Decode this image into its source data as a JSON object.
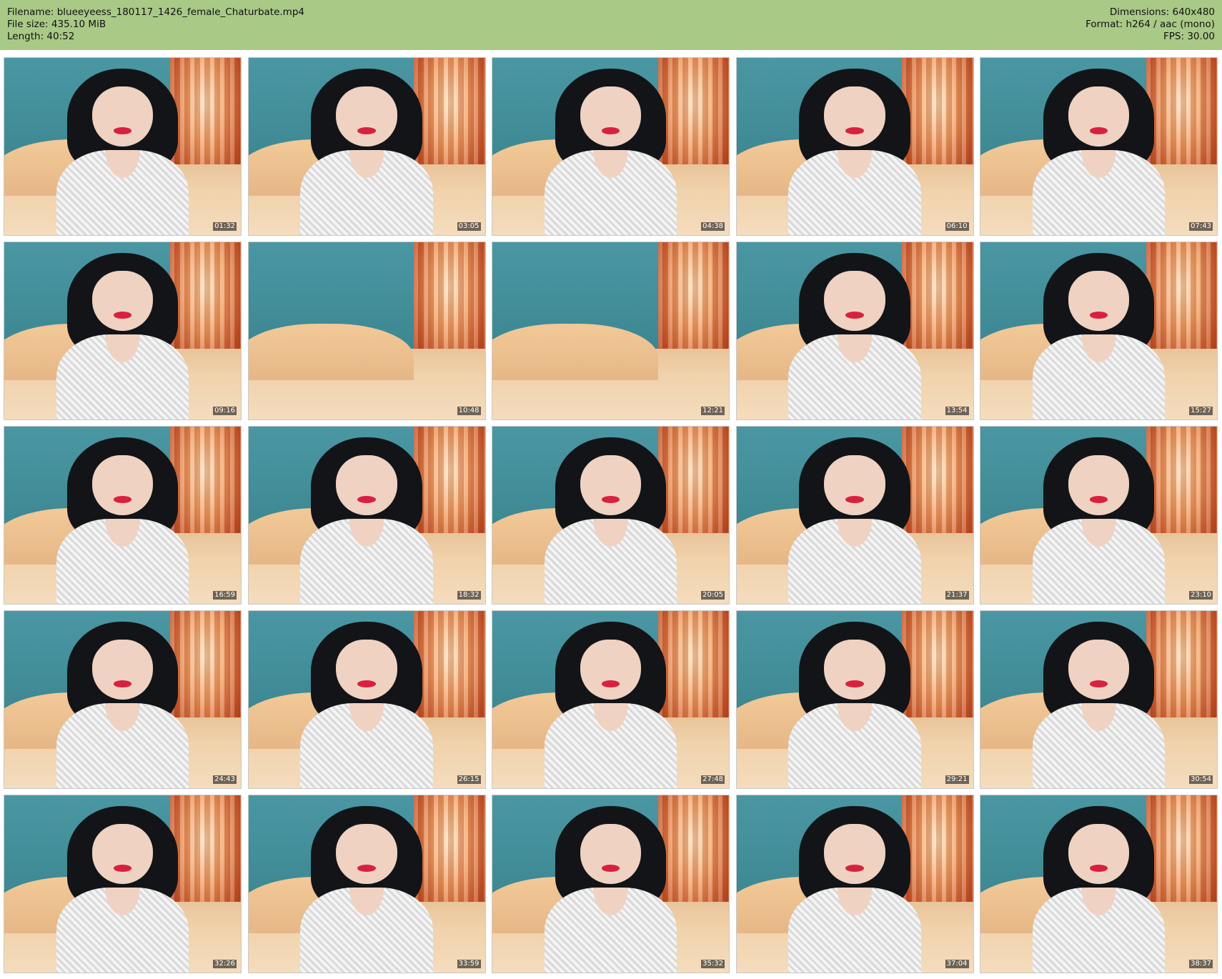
{
  "header": {
    "filename_line": "Filename: blueeyeess_180117_1426_female_Chaturbate.mp4",
    "filesize_line": "File size: 435.10 MiB",
    "length_line": "Length: 40:52",
    "dimensions_line": "Dimensions: 640x480",
    "format_line": "Format: h264 / aac (mono)",
    "fps_line": "FPS: 30.00"
  },
  "colors": {
    "header_background": "#a9c986",
    "wall": "#3d8893",
    "curtain": "#f3a46a",
    "bed": "#f1d3ad"
  },
  "thumbnails": [
    {
      "time": "01:32",
      "scene": "person"
    },
    {
      "time": "03:05",
      "scene": "person"
    },
    {
      "time": "04:38",
      "scene": "person"
    },
    {
      "time": "06:10",
      "scene": "person"
    },
    {
      "time": "07:43",
      "scene": "person"
    },
    {
      "time": "09:16",
      "scene": "person"
    },
    {
      "time": "10:48",
      "scene": "empty"
    },
    {
      "time": "12:21",
      "scene": "empty"
    },
    {
      "time": "13:54",
      "scene": "person"
    },
    {
      "time": "15:27",
      "scene": "person"
    },
    {
      "time": "16:59",
      "scene": "person"
    },
    {
      "time": "18:32",
      "scene": "person"
    },
    {
      "time": "20:05",
      "scene": "person"
    },
    {
      "time": "21:37",
      "scene": "person"
    },
    {
      "time": "23:10",
      "scene": "person"
    },
    {
      "time": "24:43",
      "scene": "person"
    },
    {
      "time": "26:15",
      "scene": "person"
    },
    {
      "time": "27:48",
      "scene": "person"
    },
    {
      "time": "29:21",
      "scene": "person"
    },
    {
      "time": "30:54",
      "scene": "person"
    },
    {
      "time": "32:26",
      "scene": "person"
    },
    {
      "time": "33:59",
      "scene": "person"
    },
    {
      "time": "35:32",
      "scene": "person"
    },
    {
      "time": "37:04",
      "scene": "person"
    },
    {
      "time": "38:37",
      "scene": "person"
    }
  ]
}
